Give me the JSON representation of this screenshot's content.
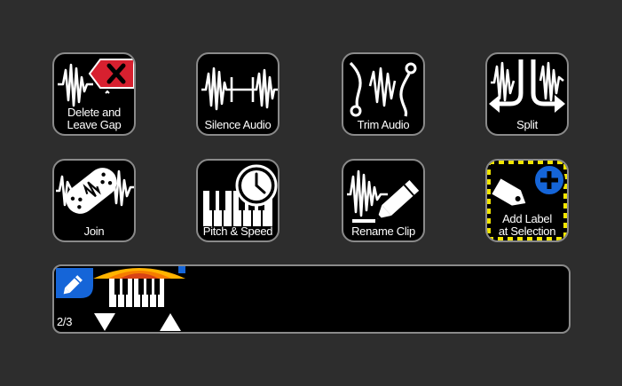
{
  "tools": [
    {
      "id": "delete-and-leave-gap",
      "label_lines": [
        "Delete and",
        "Leave Gap"
      ]
    },
    {
      "id": "silence-audio",
      "label_lines": [
        "Silence Audio"
      ]
    },
    {
      "id": "trim-audio",
      "label_lines": [
        "Trim Audio"
      ]
    },
    {
      "id": "split",
      "label_lines": [
        "Split"
      ]
    },
    {
      "id": "join",
      "label_lines": [
        "Join"
      ]
    },
    {
      "id": "pitch-and-speed",
      "label_lines": [
        "Pitch & Speed"
      ]
    },
    {
      "id": "rename-clip",
      "label_lines": [
        "Rename Clip"
      ]
    },
    {
      "id": "add-label-at-selection",
      "label_lines": [
        "Add Label",
        "at Selection"
      ]
    }
  ],
  "toolbar": {
    "page_indicator": "2/3",
    "icons": [
      "pencil-icon",
      "piano-keys-icon",
      "arrow-down-icon",
      "arrow-up-icon"
    ]
  },
  "colors": {
    "background": "#2d2d2d",
    "tile": "#000000",
    "tile_border": "#8a8a8a",
    "delete_red": "#d7202f",
    "accent_blue": "#1565d8",
    "selection_yellow": "#f2e600"
  }
}
